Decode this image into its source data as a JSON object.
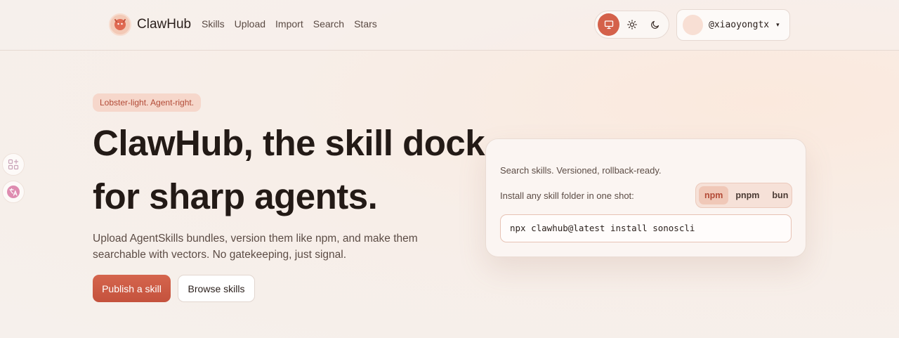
{
  "header": {
    "brand": "ClawHub",
    "nav": [
      "Skills",
      "Upload",
      "Import",
      "Search",
      "Stars"
    ],
    "theme_options": [
      "monitor-icon",
      "sun-icon",
      "moon-icon"
    ],
    "theme_active": "monitor-icon",
    "user": {
      "handle": "@xiaoyongtx",
      "caret": "▾"
    }
  },
  "hero": {
    "badge": "Lobster-light. Agent-right.",
    "title_line1": "ClawHub, the skill dock",
    "title_line2": "for sharp agents.",
    "subtitle_line1": "Upload AgentSkills bundles, version them like npm, and make them",
    "subtitle_line2": "searchable with vectors. No gatekeeping, just signal.",
    "primary_button": "Publish a skill",
    "secondary_button": "Browse skills"
  },
  "install_card": {
    "tagline": "Search skills. Versioned, rollback-ready.",
    "install_label": "Install any skill folder in one shot:",
    "package_managers": [
      "npm",
      "pnpm",
      "bun"
    ],
    "active_package_manager": "npm",
    "command": "npx clawhub@latest install sonoscli"
  },
  "colors": {
    "accent": "#d4614a",
    "badge_bg": "#f6d7cb",
    "badge_text": "#b24a36"
  }
}
